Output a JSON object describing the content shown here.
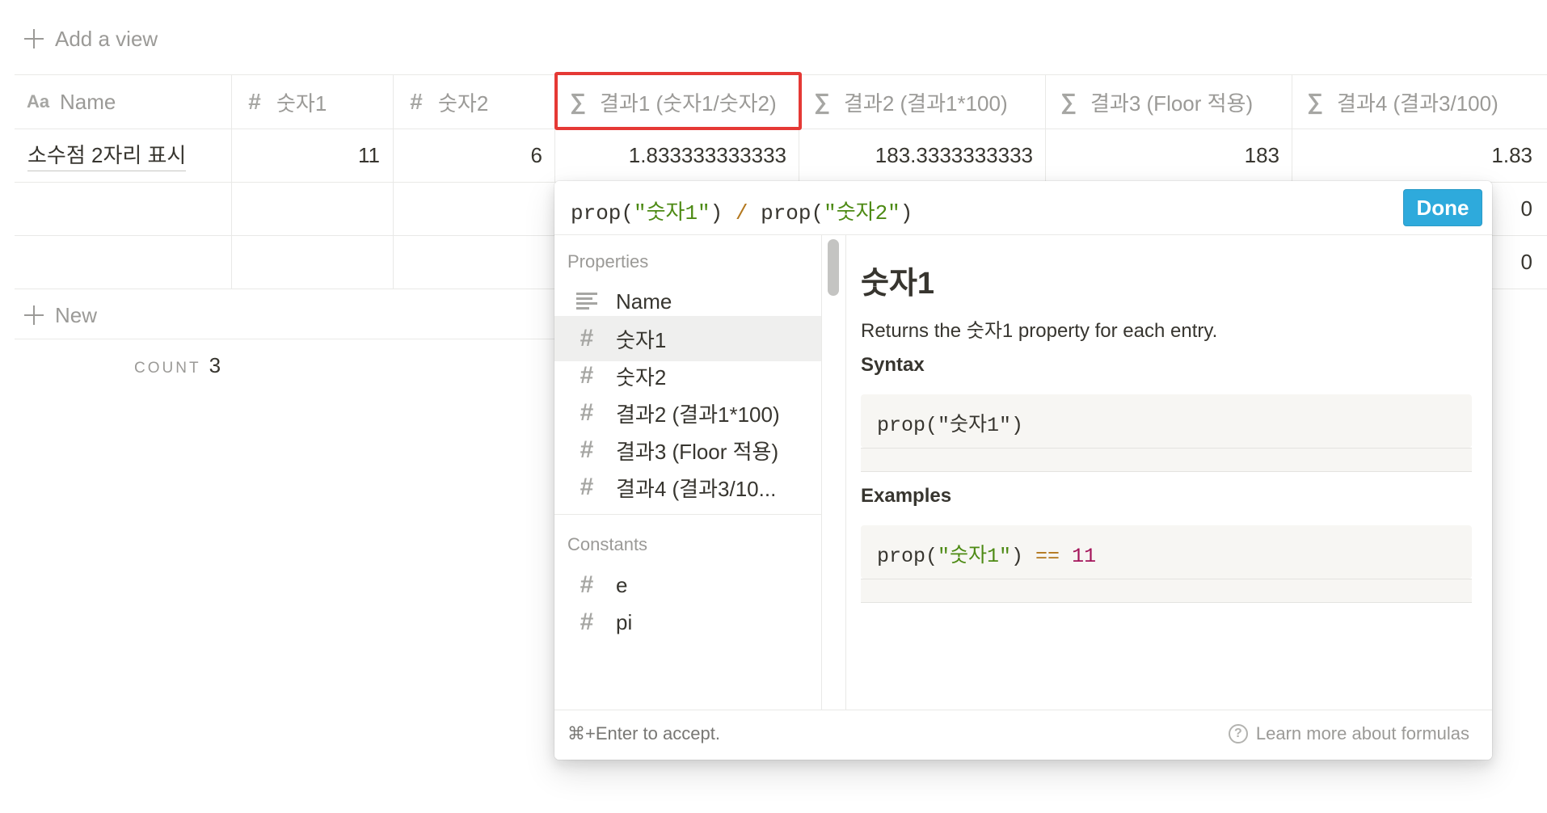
{
  "toolbar": {
    "add_view_label": "Add a view"
  },
  "table": {
    "columns": [
      {
        "icon": "text-icon",
        "icon_glyph": "Aa",
        "label": "Name"
      },
      {
        "icon": "number-icon",
        "icon_glyph": "#",
        "label": "숫자1"
      },
      {
        "icon": "number-icon",
        "icon_glyph": "#",
        "label": "숫자2"
      },
      {
        "icon": "formula-icon",
        "icon_glyph": "∑",
        "label": "결과1 (숫자1/숫자2)"
      },
      {
        "icon": "formula-icon",
        "icon_glyph": "∑",
        "label": "결과2 (결과1*100)"
      },
      {
        "icon": "formula-icon",
        "icon_glyph": "∑",
        "label": "결과3 (Floor 적용)"
      },
      {
        "icon": "formula-icon",
        "icon_glyph": "∑",
        "label": "결과4 (결과3/100)"
      }
    ],
    "rows": [
      [
        "소수점 2자리 표시",
        "11",
        "6",
        "1.833333333333",
        "183.3333333333",
        "183",
        "1.83"
      ],
      [
        "",
        "",
        "",
        "",
        "",
        "",
        "0"
      ],
      [
        "",
        "",
        "",
        "",
        "",
        "",
        "0"
      ]
    ],
    "new_label": "New",
    "count_label": "COUNT",
    "count_value": "3"
  },
  "formula_editor": {
    "formula_parts": {
      "p1": "prop(",
      "s1": "\"숫자1\"",
      "p2": ") ",
      "op": "/",
      "p3": " prop(",
      "s2": "\"숫자2\"",
      "p4": ")"
    },
    "done_label": "Done",
    "properties_label": "Properties",
    "properties": [
      {
        "icon": "text-lines-icon",
        "label": "Name"
      },
      {
        "icon": "number-icon",
        "label": "숫자1"
      },
      {
        "icon": "number-icon",
        "label": "숫자2"
      },
      {
        "icon": "number-icon",
        "label": "결과2 (결과1*100)"
      },
      {
        "icon": "number-icon",
        "label": "결과3 (Floor 적용)"
      },
      {
        "icon": "number-icon",
        "label": "결과4 (결과3/10..."
      }
    ],
    "constants_label": "Constants",
    "constants": [
      {
        "icon": "number-icon",
        "label": "e"
      },
      {
        "icon": "number-icon",
        "label": "pi"
      }
    ],
    "doc": {
      "title": "숫자1",
      "description": "Returns the 숫자1 property for each entry.",
      "syntax_label": "Syntax",
      "syntax_code": "prop(\"숫자1\")",
      "examples_label": "Examples",
      "example": {
        "p1": "prop(",
        "s1": "\"숫자1\"",
        "p2": ") ",
        "op": "==",
        "sp": " ",
        "num": "11"
      }
    },
    "footer_hint": "⌘+Enter to accept.",
    "learn_more_label": "Learn more about formulas"
  }
}
